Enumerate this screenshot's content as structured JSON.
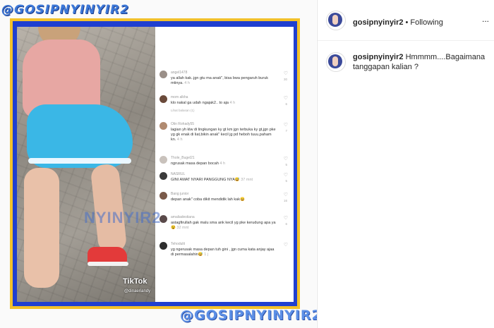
{
  "watermark": {
    "top": "@GOSIPNYINYIR2",
    "bottom": "@GOSIPNYINYIR2",
    "overlay": "NYINYIR2"
  },
  "video": {
    "platform": "TikTok",
    "handle": "@dinaeriandy"
  },
  "comments": [
    {
      "user": "angel1478",
      "text": "ya allah kak..jgn gtu ma anak\", bisa bwa pengaruh buruk mtinya.",
      "time": "4 h",
      "likes": "30"
    },
    {
      "user": "mom alkha",
      "text": "klo nakal ga udah ngajak2.. to aja",
      "time": "4 h",
      "likes": "6",
      "more": "Lihat balasan (1)"
    },
    {
      "user": "Olin Rohady55",
      "text": "lagian yh klw di lingkungan ky gt km jgn terbuka ky gt,jgn pke yg gk enak di liat,bikin anak\" kecil jg pd heboh tuuu,paham kn.",
      "time": "4 h",
      "likes": "7"
    },
    {
      "user": "Thole_Bugel21",
      "text": "ngrusak masa depan bocah",
      "time": "4 h",
      "likes": "5"
    },
    {
      "user": "NASRUL",
      "text": "GINI AMAT NYARI PANGGUNG NYA😅",
      "time": "37 mnt",
      "likes": "5"
    },
    {
      "user": "Bang junior",
      "text": "depan anak\" coba dikit mendidik lah kak😄",
      "time": "",
      "likes": "16"
    },
    {
      "user": "amaliadestiana",
      "text": "astagfirullah gak malu sma ank kecil yg pke kerudung apa ya 😵",
      "time": "32 mnt",
      "likes": "6"
    },
    {
      "user": "Tehodulit",
      "text": "yg ngerusak masa depan tuh gini , jgn cuma kata anjay ajaa di permasalahin😅",
      "time": "1 j",
      "likes": ""
    }
  ],
  "header": {
    "username": "gosipnyinyir2",
    "separator": "•",
    "follow_label": "Following",
    "menu": "..."
  },
  "post": {
    "username": "gosipnyinyir2",
    "caption": "Hmmmm....Bagaimana tanggapan kalian ?"
  },
  "icons": {
    "avatar": "profile-avatar",
    "heart": "heart-icon",
    "menu": "more-options-icon"
  }
}
